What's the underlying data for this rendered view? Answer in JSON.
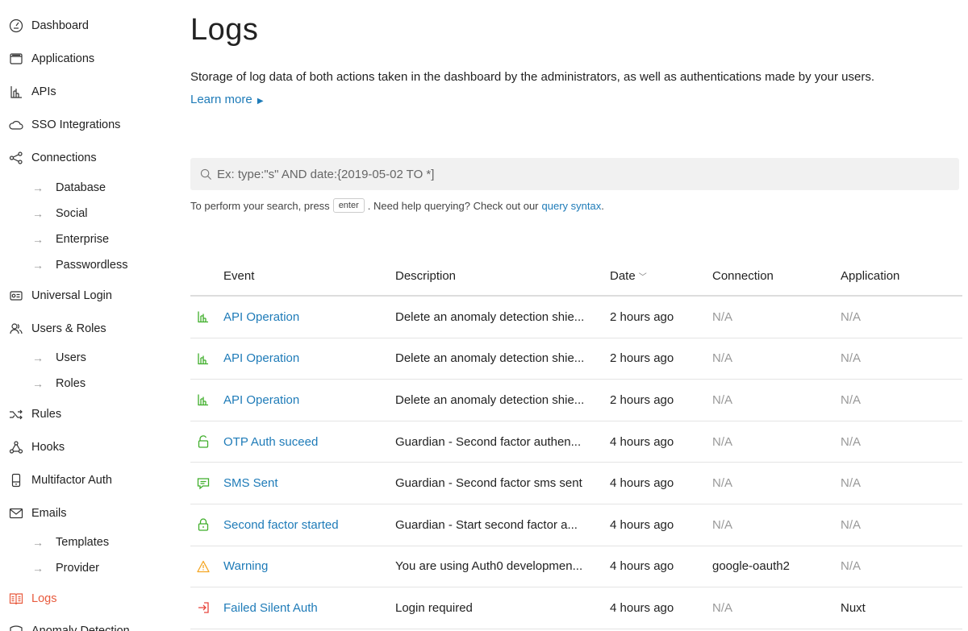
{
  "sidebar": {
    "items": [
      {
        "label": "Dashboard",
        "icon": "dashboard-icon"
      },
      {
        "label": "Applications",
        "icon": "applications-icon"
      },
      {
        "label": "APIs",
        "icon": "apis-icon"
      },
      {
        "label": "SSO Integrations",
        "icon": "cloud-icon"
      },
      {
        "label": "Connections",
        "icon": "connections-icon"
      },
      {
        "label": "Database"
      },
      {
        "label": "Social"
      },
      {
        "label": "Enterprise"
      },
      {
        "label": "Passwordless"
      },
      {
        "label": "Universal Login",
        "icon": "login-icon"
      },
      {
        "label": "Users & Roles",
        "icon": "users-icon"
      },
      {
        "label": "Users"
      },
      {
        "label": "Roles"
      },
      {
        "label": "Rules",
        "icon": "rules-icon"
      },
      {
        "label": "Hooks",
        "icon": "hooks-icon"
      },
      {
        "label": "Multifactor Auth",
        "icon": "mfa-icon"
      },
      {
        "label": "Emails",
        "icon": "email-icon"
      },
      {
        "label": "Templates"
      },
      {
        "label": "Provider"
      },
      {
        "label": "Logs",
        "icon": "logs-icon"
      },
      {
        "label": "Anomaly Detection",
        "icon": "anomaly-icon"
      }
    ],
    "active_color": "#e85a3d"
  },
  "header": {
    "title": "Logs",
    "description": "Storage of log data of both actions taken in the dashboard by the administrators, as well as authentications made by your users.",
    "learn_more": "Learn more"
  },
  "search": {
    "placeholder": "Ex: type:\"s\" AND date:{2019-05-02 TO *]",
    "help_prefix": "To perform your search, press",
    "help_key": "enter",
    "help_middle": ". Need help querying? Check out our",
    "help_link": "query syntax",
    "help_suffix": "."
  },
  "table": {
    "columns": {
      "event": "Event",
      "description": "Description",
      "date": "Date",
      "connection": "Connection",
      "application": "Application"
    },
    "rows": [
      {
        "icon": "api-icon",
        "event": "API Operation",
        "description": "Delete an anomaly detection shie...",
        "date": "2 hours ago",
        "connection": "N/A",
        "application": "N/A"
      },
      {
        "icon": "api-icon",
        "event": "API Operation",
        "description": "Delete an anomaly detection shie...",
        "date": "2 hours ago",
        "connection": "N/A",
        "application": "N/A"
      },
      {
        "icon": "api-icon",
        "event": "API Operation",
        "description": "Delete an anomaly detection shie...",
        "date": "2 hours ago",
        "connection": "N/A",
        "application": "N/A"
      },
      {
        "icon": "unlock-icon",
        "event": "OTP Auth suceed",
        "description": "Guardian - Second factor authen...",
        "date": "4 hours ago",
        "connection": "N/A",
        "application": "N/A"
      },
      {
        "icon": "message-icon",
        "event": "SMS Sent",
        "description": "Guardian - Second factor sms sent",
        "date": "4 hours ago",
        "connection": "N/A",
        "application": "N/A"
      },
      {
        "icon": "lock-icon",
        "event": "Second factor started",
        "description": "Guardian - Start second factor a...",
        "date": "4 hours ago",
        "connection": "N/A",
        "application": "N/A"
      },
      {
        "icon": "warning-icon",
        "event": "Warning",
        "description": "You are using Auth0 developmen...",
        "date": "4 hours ago",
        "connection": "google-oauth2",
        "application": "N/A"
      },
      {
        "icon": "failed-login-icon",
        "event": "Failed Silent Auth",
        "description": "Login required",
        "date": "4 hours ago",
        "connection": "N/A",
        "application": "Nuxt"
      }
    ]
  },
  "colors": {
    "link": "#1e7bb8",
    "success": "#3fae2a",
    "warning": "#f5a623",
    "error": "#e8453c"
  }
}
